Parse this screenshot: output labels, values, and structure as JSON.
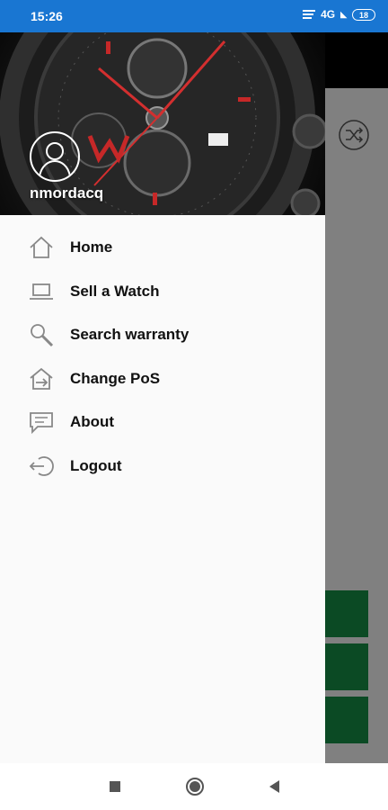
{
  "status_bar": {
    "time": "15:26",
    "network": "4G",
    "battery": "18",
    "background_color": "#1976d2"
  },
  "drawer": {
    "header": {
      "username": "nmordacq",
      "image": "tag-heuer-chronograph-watch",
      "avatar_icon": "user-icon"
    },
    "menu_items": [
      {
        "label": "Home",
        "icon": "home-icon"
      },
      {
        "label": "Sell a Watch",
        "icon": "laptop-icon"
      },
      {
        "label": "Search warranty",
        "icon": "search-icon"
      },
      {
        "label": "Change PoS",
        "icon": "house-arrow-icon"
      },
      {
        "label": "About",
        "icon": "message-icon"
      },
      {
        "label": "Logout",
        "icon": "logout-icon"
      }
    ]
  },
  "background_app": {
    "toolbar_color": "#000000",
    "content_overlay_color": "#808080",
    "tile_color": "#0b4a24",
    "action_icon": "shuffle-icon"
  },
  "nav_bar": {
    "buttons": [
      "recents-icon",
      "home-circle-icon",
      "back-icon"
    ]
  }
}
